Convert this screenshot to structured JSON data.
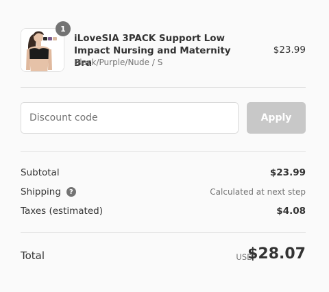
{
  "product": {
    "quantity": "1",
    "title": "iLoveSIA 3PACK Support Low Impact Nursing and Maternity Bra",
    "variant": "Black/Purple/Nude / S",
    "price": "$23.99"
  },
  "discount": {
    "placeholder": "Discount code",
    "apply_label": "Apply"
  },
  "summary": {
    "subtotal_label": "Subtotal",
    "subtotal_value": "$23.99",
    "shipping_label": "Shipping",
    "shipping_help": "?",
    "shipping_value": "Calculated at next step",
    "taxes_label": "Taxes (estimated)",
    "taxes_value": "$4.08"
  },
  "total": {
    "label": "Total",
    "currency": "USD",
    "amount": "$28.07"
  },
  "colors": {
    "apply_disabled": "#c8c8c8",
    "badge": "#737373"
  }
}
